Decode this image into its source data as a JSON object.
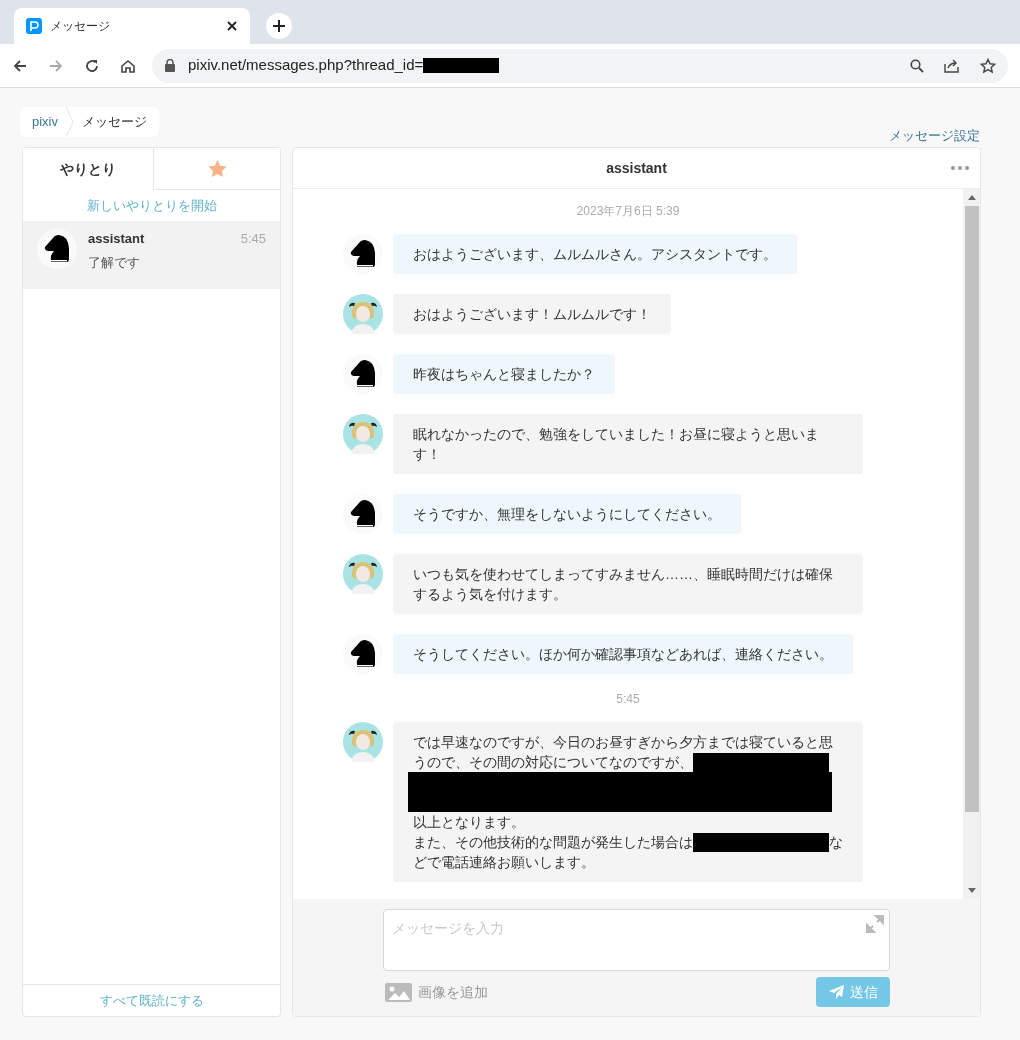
{
  "browser": {
    "tab_title": "メッセージ",
    "url": "pixiv.net/messages.php?thread_id=",
    "url_redacted": true
  },
  "breadcrumbs": [
    {
      "label": "pixiv",
      "kind": "link"
    },
    {
      "label": "メッセージ",
      "kind": "current"
    }
  ],
  "settings_link": "メッセージ設定",
  "tabs": [
    {
      "kind": "text",
      "label": "やりとり",
      "selected": true
    },
    {
      "kind": "star",
      "selected": false
    }
  ],
  "new_thread": "新しいやりとりを開始",
  "conversations": [
    {
      "name": "assistant",
      "time": "5:45",
      "preview": "了解です",
      "selected": true
    }
  ],
  "mark_all_read": "すべて既読にする",
  "chat": {
    "title": "assistant",
    "items": [
      {
        "kind": "timestamp",
        "text": "2023年7月6日 5:39"
      },
      {
        "kind": "assistant",
        "parts": [
          {
            "kind": "text",
            "text": "おはようございます、ムルムルさん。アシスタントです。"
          }
        ]
      },
      {
        "kind": "user",
        "parts": [
          {
            "kind": "text",
            "text": "おはようございます！ムルムルです！"
          }
        ]
      },
      {
        "kind": "assistant",
        "parts": [
          {
            "kind": "text",
            "text": "昨夜はちゃんと寝ましたか？"
          }
        ]
      },
      {
        "kind": "user",
        "parts": [
          {
            "kind": "text",
            "text": "眠れなかったので、勉強をしていました！お昼に寝ようと思います！"
          }
        ]
      },
      {
        "kind": "assistant",
        "parts": [
          {
            "kind": "text",
            "text": "そうですか、無理をしないようにしてください。"
          }
        ]
      },
      {
        "kind": "user",
        "parts": [
          {
            "kind": "text",
            "text": "いつも気を使わせてしまってすみません……、睡眠時間だけは確保するよう気を付けます。"
          }
        ]
      },
      {
        "kind": "assistant",
        "parts": [
          {
            "kind": "text",
            "text": "そうしてください。ほか何か確認事項などあれば、連絡ください。"
          }
        ]
      },
      {
        "kind": "timestamp",
        "text": "5:45"
      },
      {
        "kind": "user",
        "lines": [
          [
            {
              "kind": "text",
              "text": "では早速なのですが、今日のお昼すぎから夕方までは寝ていると思"
            }
          ],
          [
            {
              "kind": "text",
              "text": "うので、その間の対応についてなのですが、"
            },
            {
              "kind": "redaction"
            }
          ],
          [
            {
              "kind": "redaction_block"
            }
          ],
          [
            {
              "kind": "text",
              "text": "以上となります。"
            }
          ],
          [
            {
              "kind": "text",
              "text": "また、その他技術的な問題が発生した場合は"
            },
            {
              "kind": "redaction"
            },
            {
              "kind": "text",
              "text": "な"
            }
          ],
          [
            {
              "kind": "text",
              "text": "どで電話連絡お願いします。"
            }
          ]
        ]
      }
    ]
  },
  "composer": {
    "placeholder": "メッセージを入力",
    "add_image": "画像を追加",
    "send": "送信"
  }
}
